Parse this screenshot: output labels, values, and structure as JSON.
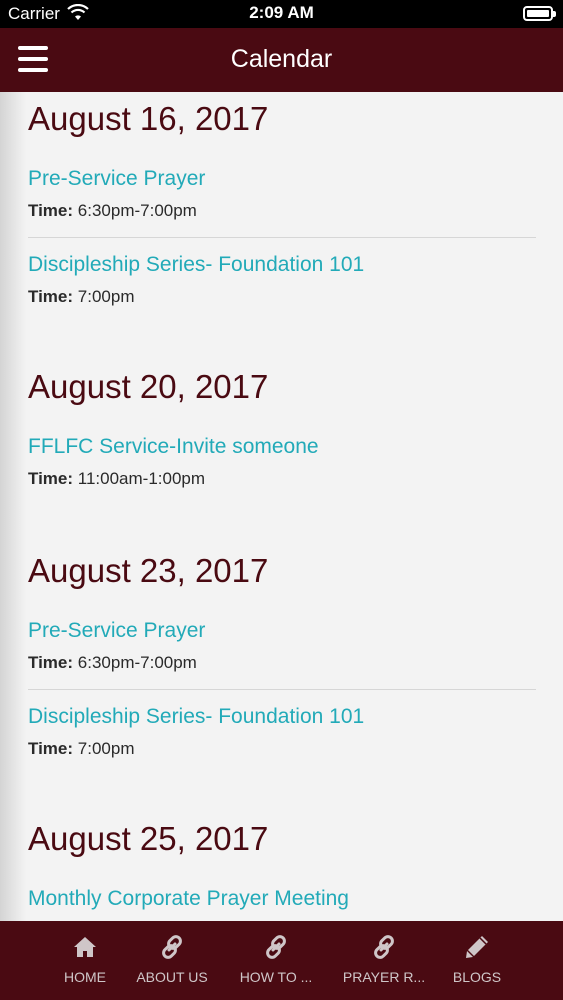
{
  "status_bar": {
    "carrier": "Carrier",
    "time": "2:09 AM"
  },
  "nav": {
    "title": "Calendar"
  },
  "days": [
    {
      "date": "August 16, 2017",
      "events": [
        {
          "title": "Pre-Service Prayer",
          "time_label": "Time:",
          "time": "6:30pm-7:00pm"
        },
        {
          "title": "Discipleship Series- Foundation 101",
          "time_label": "Time:",
          "time": "7:00pm"
        }
      ]
    },
    {
      "date": "August 20, 2017",
      "events": [
        {
          "title": "FFLFC Service-Invite someone",
          "time_label": "Time:",
          "time": "11:00am-1:00pm"
        }
      ]
    },
    {
      "date": "August 23, 2017",
      "events": [
        {
          "title": "Pre-Service Prayer",
          "time_label": "Time:",
          "time": "6:30pm-7:00pm"
        },
        {
          "title": "Discipleship Series- Foundation 101",
          "time_label": "Time:",
          "time": "7:00pm"
        }
      ]
    },
    {
      "date": "August 25, 2017",
      "events": [
        {
          "title": "Monthly Corporate Prayer Meeting"
        }
      ]
    }
  ],
  "tabs": [
    {
      "label": "HOME",
      "icon": "home-icon"
    },
    {
      "label": "ABOUT US",
      "icon": "link-icon"
    },
    {
      "label": "HOW TO ...",
      "icon": "link-icon"
    },
    {
      "label": "PRAYER R...",
      "icon": "link-icon"
    },
    {
      "label": "BLOGS",
      "icon": "pencil-icon"
    }
  ],
  "colors": {
    "brand": "#4a0a12",
    "event_title": "#22aab8",
    "tab_text": "#cfc6c8"
  }
}
